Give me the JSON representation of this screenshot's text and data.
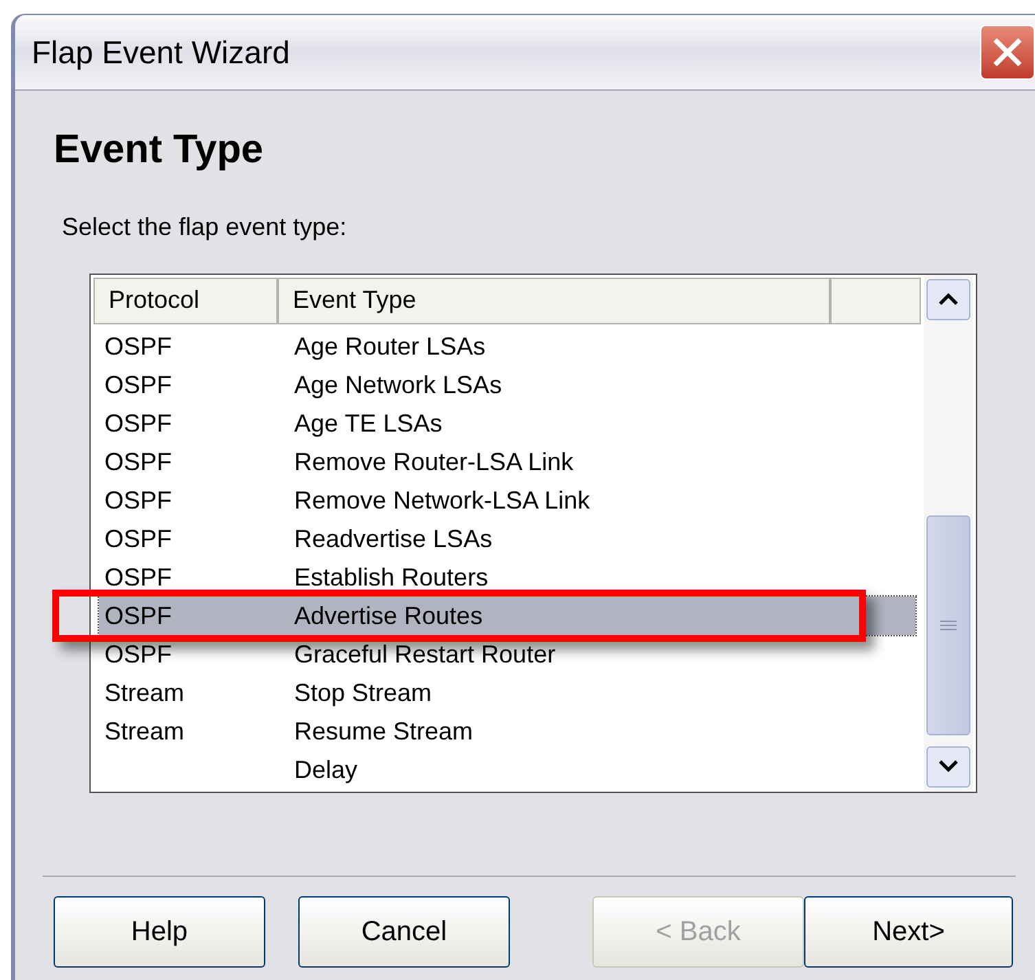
{
  "window": {
    "title": "Flap Event Wizard"
  },
  "heading": "Event Type",
  "prompt": "Select the flap event type:",
  "table": {
    "columns": [
      "Protocol",
      "Event Type"
    ],
    "rows": [
      {
        "protocol": "OSPF",
        "event_type": "Age Router LSAs",
        "selected": false
      },
      {
        "protocol": "OSPF",
        "event_type": "Age Network LSAs",
        "selected": false
      },
      {
        "protocol": "OSPF",
        "event_type": "Age TE LSAs",
        "selected": false
      },
      {
        "protocol": "OSPF",
        "event_type": "Remove Router-LSA Link",
        "selected": false
      },
      {
        "protocol": "OSPF",
        "event_type": "Remove Network-LSA Link",
        "selected": false
      },
      {
        "protocol": "OSPF",
        "event_type": "Readvertise LSAs",
        "selected": false
      },
      {
        "protocol": "OSPF",
        "event_type": "Establish Routers",
        "selected": false
      },
      {
        "protocol": "OSPF",
        "event_type": "Advertise Routes",
        "selected": true
      },
      {
        "protocol": "OSPF",
        "event_type": "Graceful Restart Router",
        "selected": false
      },
      {
        "protocol": "Stream",
        "event_type": "Stop Stream",
        "selected": false
      },
      {
        "protocol": "Stream",
        "event_type": "Resume Stream",
        "selected": false
      },
      {
        "protocol": "",
        "event_type": "Delay",
        "selected": false
      }
    ]
  },
  "buttons": [
    {
      "label": "Help",
      "disabled": false
    },
    {
      "label": "Cancel",
      "disabled": false
    },
    {
      "label": "< Back",
      "disabled": true
    },
    {
      "label": "Next>",
      "disabled": false
    }
  ]
}
